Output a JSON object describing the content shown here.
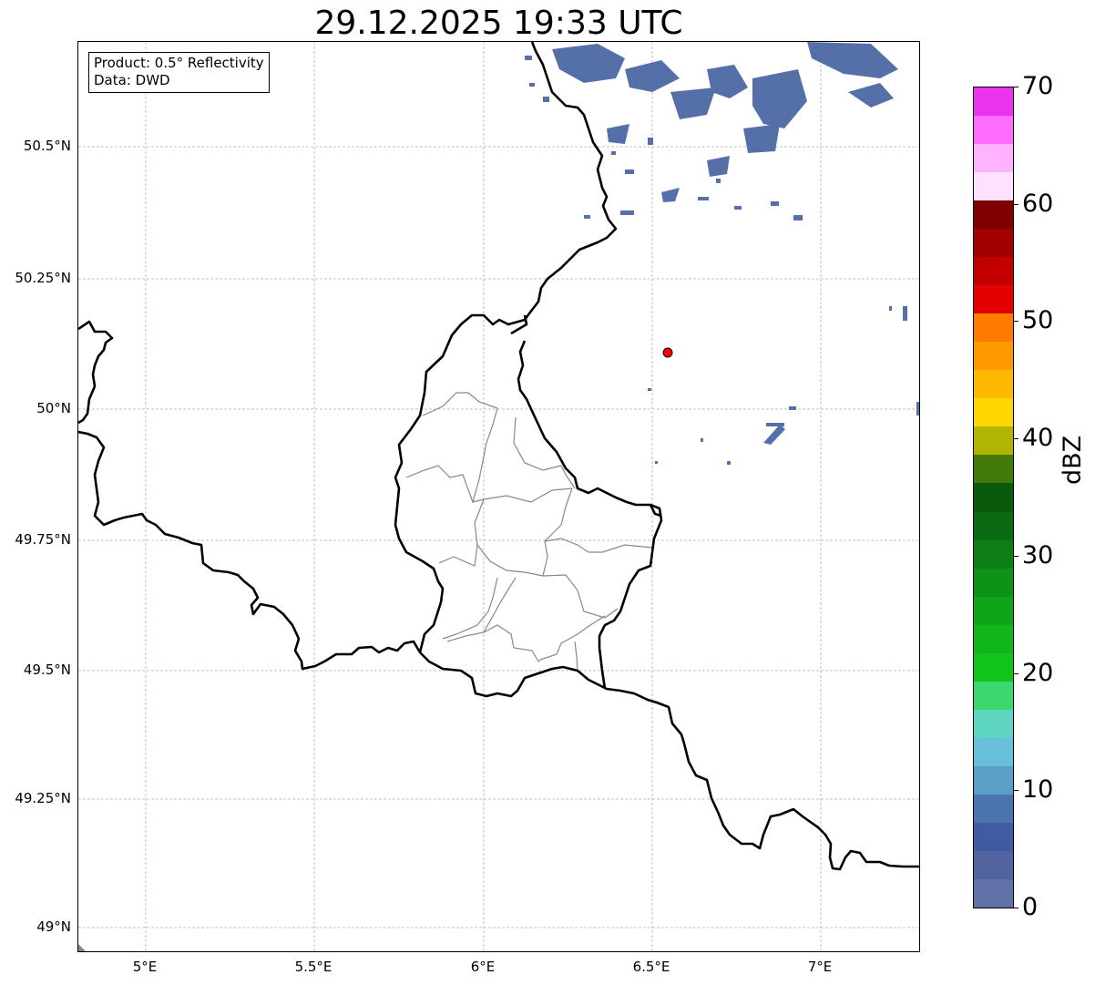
{
  "title": "29.12.2025 19:33 UTC",
  "info": {
    "product": "Product: 0.5° Reflectivity",
    "source": "Data: DWD"
  },
  "axes": {
    "lat_labels": [
      "50.5°N",
      "50.25°N",
      "50°N",
      "49.75°N",
      "49.5°N",
      "49.25°N",
      "49°N"
    ],
    "lon_labels": [
      "5°E",
      "5.5°E",
      "6°E",
      "6.5°E",
      "7°E"
    ]
  },
  "colorbar": {
    "title": "dBZ",
    "tick_labels": [
      "0",
      "10",
      "20",
      "30",
      "40",
      "50",
      "60",
      "70"
    ],
    "colors": [
      "#6272a8",
      "#51649f",
      "#405ba0",
      "#4a74ad",
      "#5b9ec6",
      "#66c0d8",
      "#5fd6bf",
      "#3ed66e",
      "#12c41a",
      "#11b61a",
      "#10a518",
      "#0e9318",
      "#0c7e14",
      "#0a6b12",
      "#0a5a0e",
      "#447a0a",
      "#b0b403",
      "#ffd700",
      "#ffb900",
      "#ff9900",
      "#ff7a00",
      "#e50000",
      "#c20000",
      "#a20000",
      "#7e0000",
      "#ffe0ff",
      "#ffb3ff",
      "#ff6dff",
      "#ec34ee"
    ]
  },
  "marker": {
    "name": "radar-site",
    "color": "#ff0000"
  },
  "colors": {
    "border": "#000000",
    "district": "#888888",
    "grid": "#b0b0b0",
    "echo": "#5570a8"
  }
}
